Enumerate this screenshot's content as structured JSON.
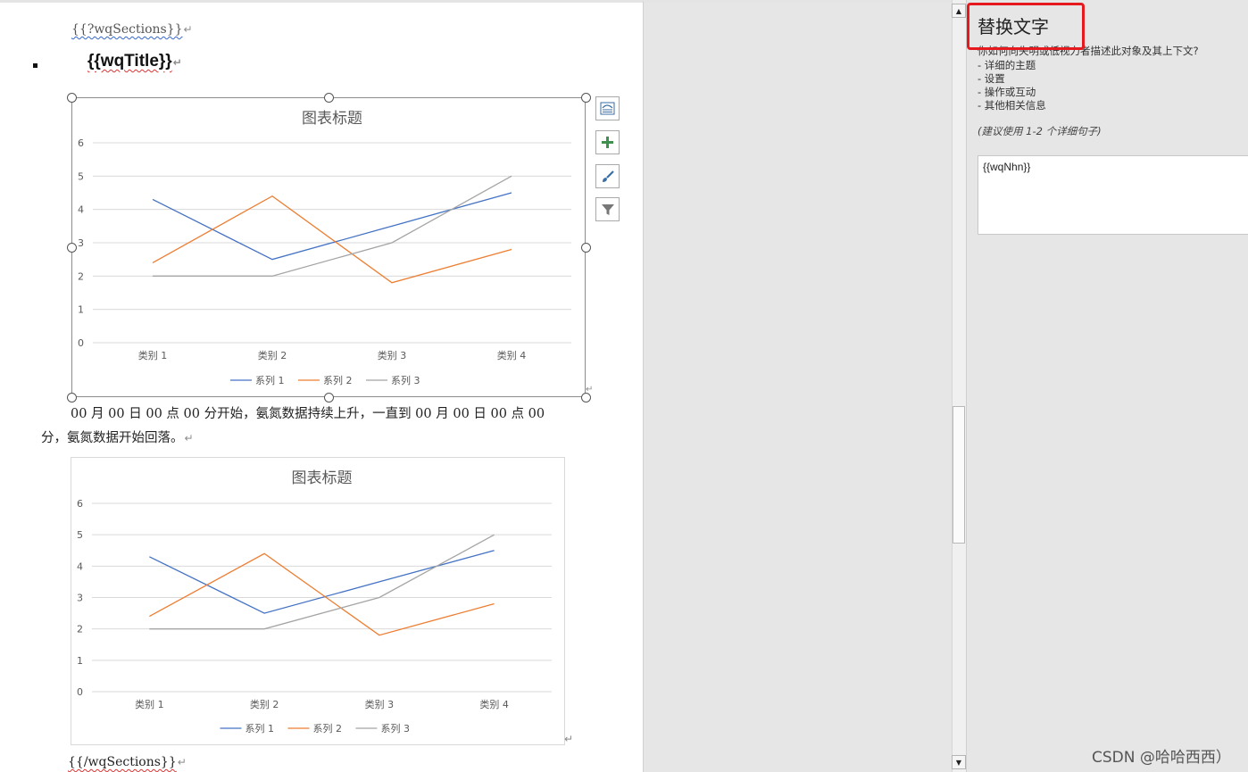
{
  "document": {
    "sections_open": "{{?wqSections}}",
    "title_placeholder": "{{wqTitle}}",
    "paragraph": "00 月 00 日 00 点 00 分开始，氨氮数据持续上升，一直到 00 月 00 日 00 点 00 分，氨氮数据开始回落。",
    "sections_close": "{{/wqSections}}",
    "paragraph_mark": "↵"
  },
  "chart_data": [
    {
      "type": "line",
      "title": "图表标题",
      "categories": [
        "类别 1",
        "类别 2",
        "类别 3",
        "类别 4"
      ],
      "series": [
        {
          "name": "系列 1",
          "values": [
            4.3,
            2.5,
            3.5,
            4.5
          ],
          "color": "#4472c4"
        },
        {
          "name": "系列 2",
          "values": [
            2.4,
            4.4,
            1.8,
            2.8
          ],
          "color": "#ed7d31"
        },
        {
          "name": "系列 3",
          "values": [
            2,
            2,
            3,
            5
          ],
          "color": "#a5a5a5"
        }
      ],
      "yticks": [
        "0",
        "1",
        "2",
        "3",
        "4",
        "5",
        "6"
      ],
      "ylim": [
        0,
        6
      ],
      "grid": true,
      "legend": "bottom",
      "selected": true
    },
    {
      "type": "line",
      "title": "图表标题",
      "categories": [
        "类别 1",
        "类别 2",
        "类别 3",
        "类别 4"
      ],
      "series": [
        {
          "name": "系列 1",
          "values": [
            4.3,
            2.5,
            3.5,
            4.5
          ],
          "color": "#4472c4"
        },
        {
          "name": "系列 2",
          "values": [
            2.4,
            4.4,
            1.8,
            2.8
          ],
          "color": "#ed7d31"
        },
        {
          "name": "系列 3",
          "values": [
            2,
            2,
            3,
            5
          ],
          "color": "#a5a5a5"
        }
      ],
      "yticks": [
        "0",
        "1",
        "2",
        "3",
        "4",
        "5",
        "6"
      ],
      "ylim": [
        0,
        6
      ],
      "grid": true,
      "legend": "bottom",
      "selected": false
    }
  ],
  "chart_tools": [
    {
      "name": "layout-options-icon"
    },
    {
      "name": "chart-elements-icon"
    },
    {
      "name": "chart-styles-icon"
    },
    {
      "name": "chart-filters-icon"
    }
  ],
  "alt_text_pane": {
    "title": "替换文字",
    "question": "你如何向失明或低视力者描述此对象及其上下文?",
    "items": [
      "- 详细的主题",
      "- 设置",
      "- 操作或互动",
      "- 其他相关信息"
    ],
    "hint": "(建议使用 1-2 个详细句子)",
    "input_value": "{{wqNhn}}",
    "highlight_color": "#e6191e"
  },
  "watermark": "CSDN @哈哈西西）"
}
